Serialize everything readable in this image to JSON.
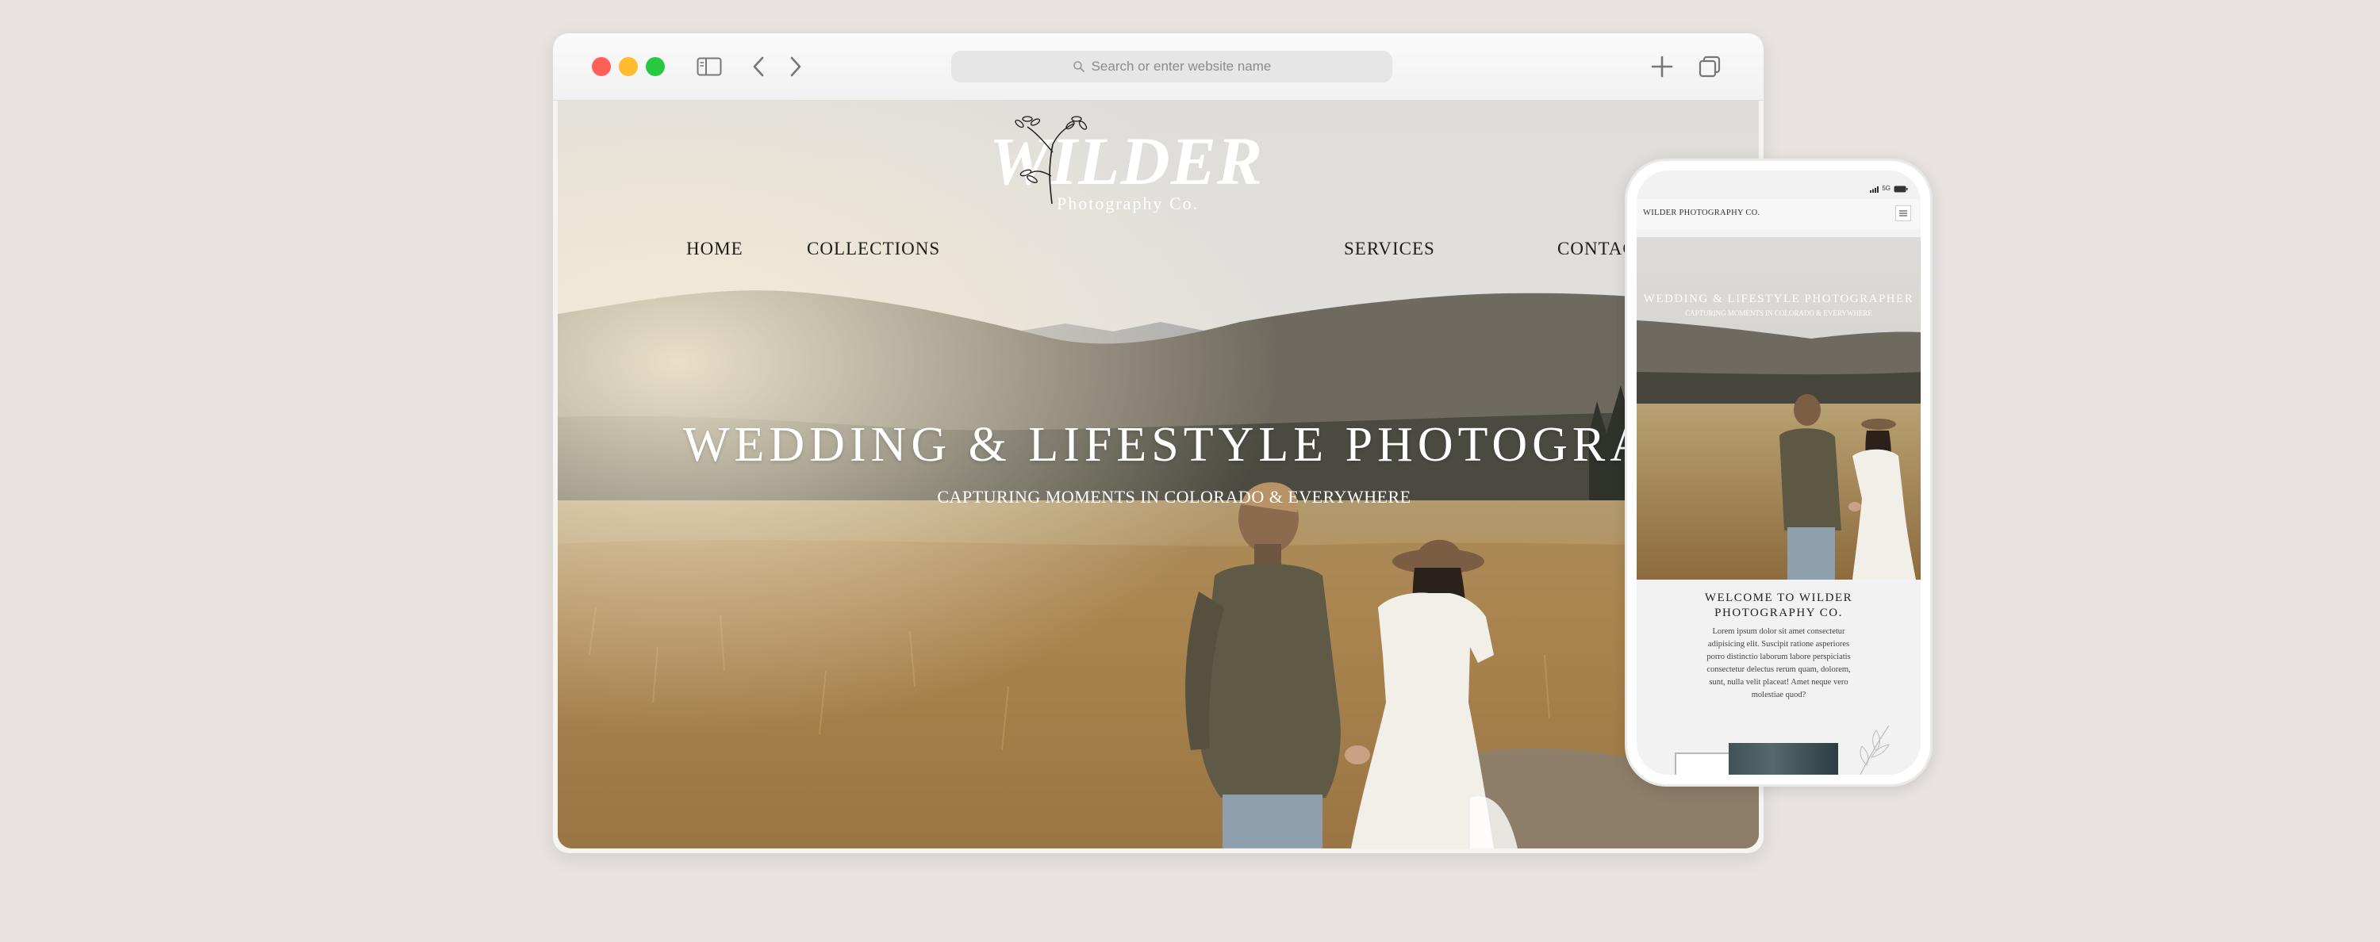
{
  "browser": {
    "address_placeholder": "Search or enter website name",
    "icons": [
      "sidebar-icon",
      "back-icon",
      "forward-icon",
      "plus-icon",
      "tabs-icon",
      "search-icon"
    ]
  },
  "site": {
    "logo_main": "WILDER",
    "logo_sub": "Photography Co.",
    "nav": [
      "HOME",
      "COLLECTIONS",
      "SERVICES",
      "CONTACT"
    ],
    "hero_title": "WEDDING & LIFESTYLE PHOTOGRAPHER",
    "hero_subtitle": "CAPTURING MOMENTS IN COLORADO & EVERYWHERE"
  },
  "mobile": {
    "status_network": "5G",
    "brand": "WILDER PHOTOGRAPHY CO.",
    "hero_title": "WEDDING & LIFESTYLE PHOTOGRAPHER",
    "hero_subtitle": "CAPTURING MOMENTS IN COLORADO & EVERYWHERE",
    "welcome_title": "WELCOME TO WILDER PHOTOGRAPHY CO.",
    "welcome_body": "Lorem ipsum dolor sit amet consectetur adipisicing elit. Suscipit ratione asperiores porro distinctio laborum labore perspiciatis consectetur delectus rerum quam, dolorem, sunt, nulla velit placeat! Amet neque vero molestiae quod?"
  },
  "colors": {
    "background": "#e8e3e0",
    "traffic_red": "#ff5f57",
    "traffic_yellow": "#febc2e",
    "traffic_green": "#28c840"
  }
}
